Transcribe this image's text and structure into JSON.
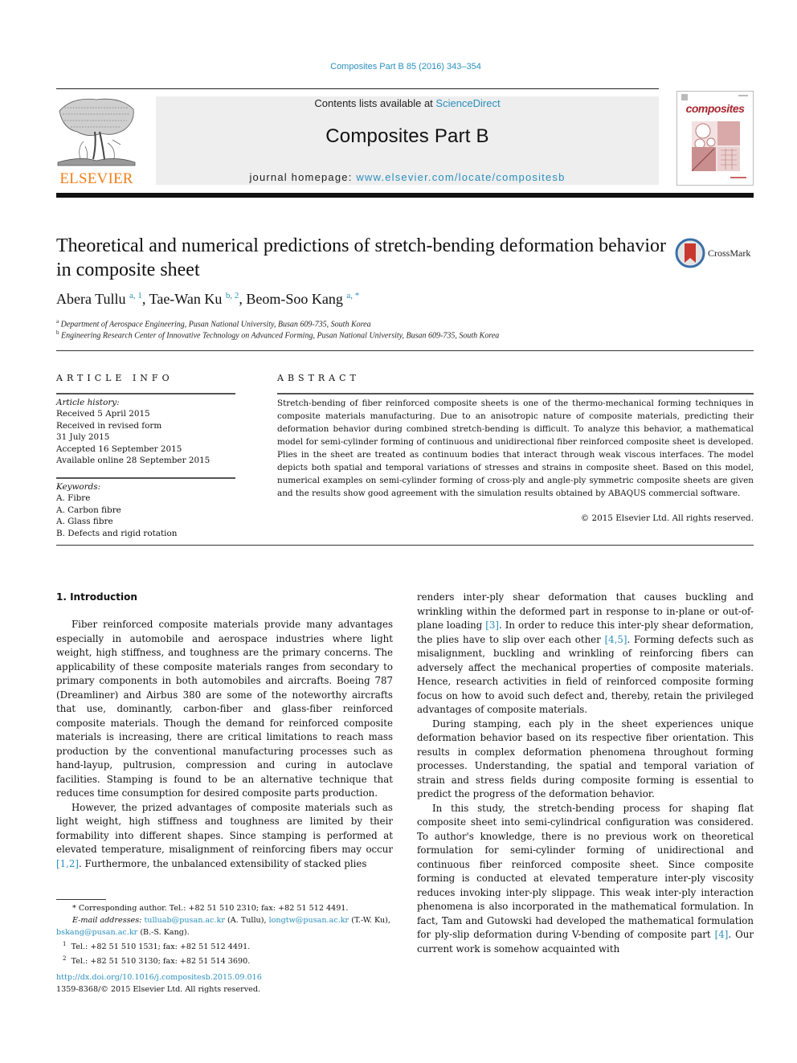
{
  "header": {
    "journal_ref": "Composites Part B 85 (2016) 343–354",
    "contents_prefix": "Contents lists available at ",
    "contents_link": "ScienceDirect",
    "journal_name": "Composites Part B",
    "homepage_prefix": "journal homepage: ",
    "homepage_link": "www.elsevier.com/locate/compositesb",
    "publisher_logo_text": "ELSEVIER",
    "cover_title": "composites",
    "colors": {
      "link": "#2a8fbd",
      "elsevier_orange": "#f07f1a",
      "cover_red": "#a8262e"
    }
  },
  "article": {
    "title": "Theoretical and numerical predictions of stretch-bending deformation behavior in composite sheet",
    "crossmark_label": "CrossMark",
    "authors": [
      {
        "name": "Abera Tullu",
        "sup": "a, 1"
      },
      {
        "name": "Tae-Wan Ku",
        "sup": "b, 2"
      },
      {
        "name": "Beom-Soo Kang",
        "sup": "a, *"
      }
    ],
    "affiliations": [
      {
        "mark": "a",
        "text": "Department of Aerospace Engineering, Pusan National University, Busan 609-735, South Korea"
      },
      {
        "mark": "b",
        "text": "Engineering Research Center of Innovative Technology on Advanced Forming, Pusan National University, Busan 609-735, South Korea"
      }
    ]
  },
  "article_info": {
    "heading": "ARTICLE INFO",
    "history_label": "Article history:",
    "history": [
      "Received 5 April 2015",
      "Received in revised form",
      "31 July 2015",
      "Accepted 16 September 2015",
      "Available online 28 September 2015"
    ],
    "keywords_label": "Keywords:",
    "keywords": [
      "A. Fibre",
      "A. Carbon fibre",
      "A. Glass fibre",
      "B. Defects and rigid rotation"
    ]
  },
  "abstract": {
    "heading": "ABSTRACT",
    "text": "Stretch-bending of fiber reinforced composite sheets is one of the thermo-mechanical forming techniques in composite materials manufacturing. Due to an anisotropic nature of composite materials, predicting their deformation behavior during combined stretch-bending is difficult. To analyze this behavior, a mathematical model for semi-cylinder forming of continuous and unidirectional fiber reinforced composite sheet is developed. Plies in the sheet are treated as continuum bodies that interact through weak viscous interfaces. The model depicts both spatial and temporal variations of stresses and strains in composite sheet. Based on this model, numerical examples on semi-cylinder forming of cross-ply and angle-ply symmetric composite sheets are given and the results show good agreement with the simulation results obtained by ABAQUS commercial software.",
    "copyright": "© 2015 Elsevier Ltd. All rights reserved."
  },
  "body": {
    "section_heading": "1.  Introduction",
    "left": {
      "p1": "Fiber reinforced composite materials provide many advantages especially in automobile and aerospace industries where light weight, high stiffness, and toughness are the primary concerns. The applicability of these composite materials ranges from secondary to primary components in both automobiles and aircrafts. Boeing 787 (Dreamliner) and Airbus 380 are some of the noteworthy aircrafts that use, dominantly, carbon-fiber and glass-fiber reinforced composite materials. Though the demand for reinforced composite materials is increasing, there are critical limitations to reach mass production by the conventional manufacturing processes such as hand-layup, pultrusion, compression and curing in autoclave facilities. Stamping is found to be an alternative technique that reduces time consumption for desired composite parts production.",
      "p2_before": "However, the prized advantages of composite materials such as light weight, high stiffness and toughness are limited by their formability into different shapes. Since stamping is performed at elevated temperature, misalignment of reinforcing fibers may occur ",
      "p2_ref": "[1,2]",
      "p2_after": ". Furthermore, the unbalanced extensibility of stacked plies"
    },
    "right": {
      "p1_a": "renders inter-ply shear deformation that causes buckling and wrinkling within the deformed part in response to in-plane or out-of-plane loading ",
      "p1_ref1": "[3]",
      "p1_b": ". In order to reduce this inter-ply shear deformation, the plies have to slip over each other ",
      "p1_ref2": "[4,5]",
      "p1_c": ". Forming defects such as misalignment, buckling and wrinkling of reinforcing fibers can adversely affect the mechanical properties of composite materials. Hence, research activities in field of reinforced composite forming focus on how to avoid such defect and, thereby, retain the privileged advantages of composite materials.",
      "p2": "During stamping, each ply in the sheet experiences unique deformation behavior based on its respective fiber orientation. This results in complex deformation phenomena throughout forming processes. Understanding, the spatial and temporal variation of strain and stress fields during composite forming is essential to predict the progress of the deformation behavior.",
      "p3_a": "In this study, the stretch-bending process for shaping flat composite sheet into semi-cylindrical configuration was considered. To author's knowledge, there is no previous work on theoretical formulation for semi-cylinder forming of unidirectional and continuous fiber reinforced composite sheet. Since composite forming is conducted at elevated temperature inter-ply viscosity reduces invoking inter-ply slippage. This weak inter-ply interaction phenomena is also incorporated in the mathematical formulation. In fact, Tam and Gutowski had developed the mathematical formulation for ply-slip deformation during V-bending of composite part ",
      "p3_ref": "[4]",
      "p3_b": ". Our current work is somehow acquainted with"
    }
  },
  "footnotes": {
    "corresponding": "Corresponding author. Tel.: +82 51 510 2310; fax: +82 51 512 4491.",
    "email_label": "E-mail addresses:",
    "emails": [
      {
        "address": "tulluab@pusan.ac.kr",
        "who": "(A. Tullu),"
      },
      {
        "address": "longtw@pusan.ac.kr",
        "who": "(T.-W. Ku),"
      },
      {
        "address": "bskang@pusan.ac.kr",
        "who": "(B.-S. Kang)."
      }
    ],
    "fn1": "Tel.: +82 51 510 1531; fax: +82 51 512 4491.",
    "fn2": "Tel.: +82 51 510 3130; fax: +82 51 514 3690.",
    "doi": "http://dx.doi.org/10.1016/j.compositesb.2015.09.016",
    "issn": "1359-8368/© 2015 Elsevier Ltd. All rights reserved."
  }
}
